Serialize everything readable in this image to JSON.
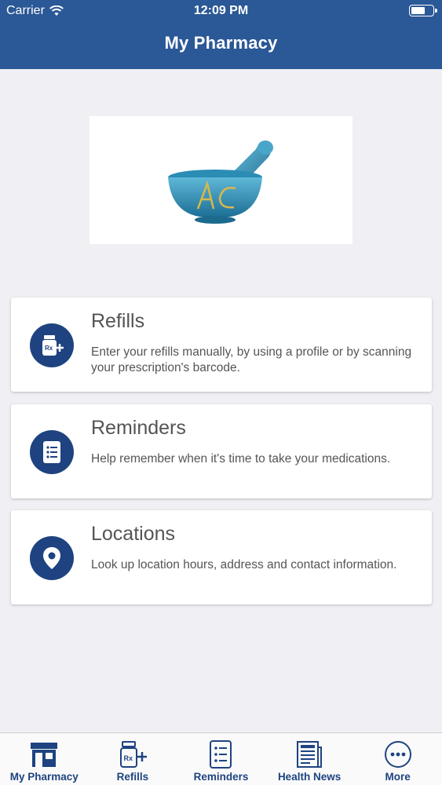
{
  "status_bar": {
    "carrier": "Carrier",
    "time": "12:09 PM"
  },
  "header": {
    "title": "My Pharmacy"
  },
  "colors": {
    "header": "#2b5896",
    "accent": "#1e4380",
    "background": "#efeff4"
  },
  "cards": [
    {
      "title": "Refills",
      "description": "Enter your refills manually, by using a profile or by scanning your prescription's barcode.",
      "icon": "rx-bottle-icon"
    },
    {
      "title": "Reminders",
      "description": "Help remember when it's time to take your medications.",
      "icon": "list-icon"
    },
    {
      "title": "Locations",
      "description": "Look up location hours, address and contact information.",
      "icon": "location-pin-icon"
    }
  ],
  "tabs": [
    {
      "label": "My Pharmacy",
      "icon": "store-icon"
    },
    {
      "label": "Refills",
      "icon": "rx-bottle-icon"
    },
    {
      "label": "Reminders",
      "icon": "list-icon"
    },
    {
      "label": "Health News",
      "icon": "news-icon"
    },
    {
      "label": "More",
      "icon": "more-icon"
    }
  ]
}
